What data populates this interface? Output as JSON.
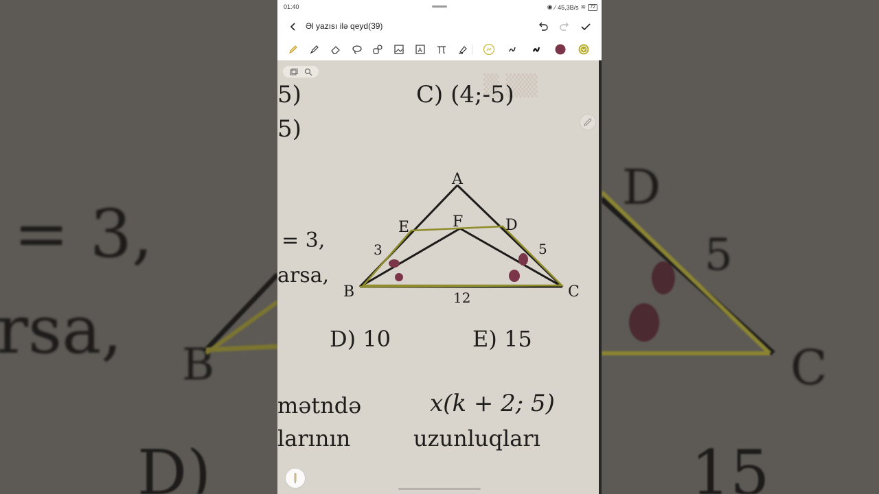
{
  "status": {
    "time": "01:40",
    "net_speed": "45,3B/s",
    "battery": "72"
  },
  "header": {
    "title": "Əl yazısı ilə qeyd(39)"
  },
  "toolbar": {
    "tools": [
      "pencil-icon",
      "highlighter-icon",
      "eraser-icon",
      "lasso-icon",
      "shapes-icon",
      "image-icon",
      "text-box-icon",
      "formula-icon",
      "ink-fill-icon"
    ],
    "pen_styles": [
      "pen-style-1",
      "pen-style-2",
      "pen-style-3"
    ],
    "current_color": "#7a3548",
    "accent_color": "#b8ad2a"
  },
  "photo": {
    "opt_c": "C) (4;-5)",
    "frag_1": "5)",
    "frag_2": "5)",
    "frag_3": "= 3,",
    "frag_4": "arsa,",
    "label_a": "A",
    "label_e": "E",
    "label_f": "F",
    "label_d": "D",
    "label_b": "B",
    "label_c": "C",
    "len_3": "3",
    "len_5": "5",
    "len_12": "12",
    "opt_d": "D) 10",
    "opt_e": "E) 15",
    "line_1a": "mətndə",
    "line_1b": "x(k + 2; 5)",
    "line_2a": "larının",
    "line_2b": "uzunluqları"
  },
  "background": {
    "left_1": "= 3,",
    "left_2": "rsa,",
    "left_3": "B",
    "right_1": "D",
    "right_2": "5",
    "right_3": "C"
  }
}
